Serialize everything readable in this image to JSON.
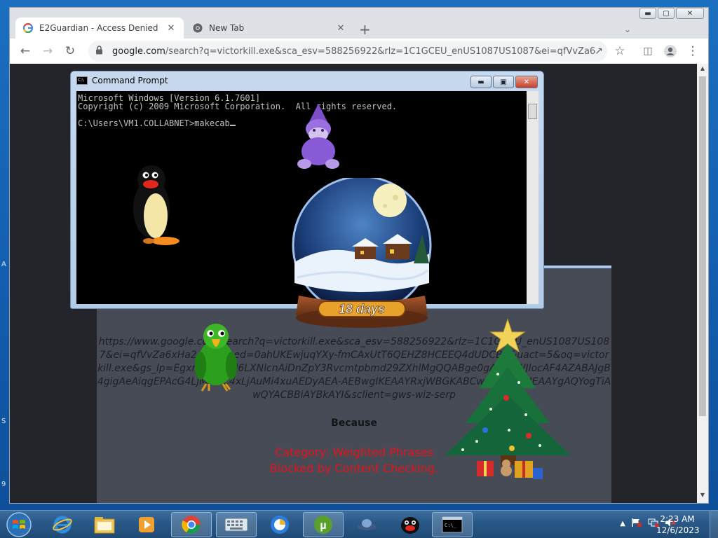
{
  "browser": {
    "tabs": [
      {
        "title": "E2Guardian - Access Denied",
        "active": true
      },
      {
        "title": "New Tab",
        "active": false
      }
    ],
    "new_tab_label": "+",
    "address": {
      "host": "google.com",
      "path": "/search?q=victorkill.exe&sca_esv=588256922&rlz=1C1GCEU_enUS1087US1087&ei=qfVvZa6xH..."
    }
  },
  "blocked_page": {
    "url": "https://www.google.com/search?q=victorkill.exe&sca_esv=588256922&rlz=1C1GCEU_enUS1087US1087&ei=qfVvZa6xHa2giAQ&ved=0ahUKEwjuqYXy-fmCAxUtT6QEHZ8HCEEQ4dUDCBA&uact=5&oq=victorkill.exe&gs_lp=Egxnd3Mtd2l6LXNlcnAiDnZpY3Rvcmtpbmd29ZXhlMgQQABge0gAlHAJWJlocAF4AZABAJgB4gigAeAiqgEPAcG4LjMuMC4xLjAuMi4xuAEDyAEA-AEBwgIKEAAYRxjWBGKABCwGKABwgIIEAAYgAQYogTiAwQYACBBiAYBkAYI&sclient=gws-wiz-serp",
    "because_label": "Because",
    "category_line1": "Category: Weighted Phrases",
    "category_line2": "Blocked by Content Checking."
  },
  "cmd": {
    "title": "Command Prompt",
    "line1": "Microsoft Windows [Version 6.1.7601]",
    "line2": "Copyright (c) 2009 Microsoft Corporation.  All rights reserved.",
    "prompt": "C:\\Users\\VM1.COLLABNET>makecab"
  },
  "snowglobe": {
    "days_label": "18 days"
  },
  "taskbar": {
    "apps": [
      "start-orb",
      "internet-explorer",
      "file-explorer",
      "media-player",
      "chrome",
      "on-screen-keyboard",
      "browser-app",
      "utorrent",
      "ufo-app",
      "pingu-app",
      "command-prompt"
    ],
    "clock_time": "2:23 AM",
    "clock_date": "12/6/2023"
  },
  "colors": {
    "blocked_text_red": "#e8111a",
    "desktop_blue": "#1561b3",
    "page_bg": "#474b56"
  }
}
